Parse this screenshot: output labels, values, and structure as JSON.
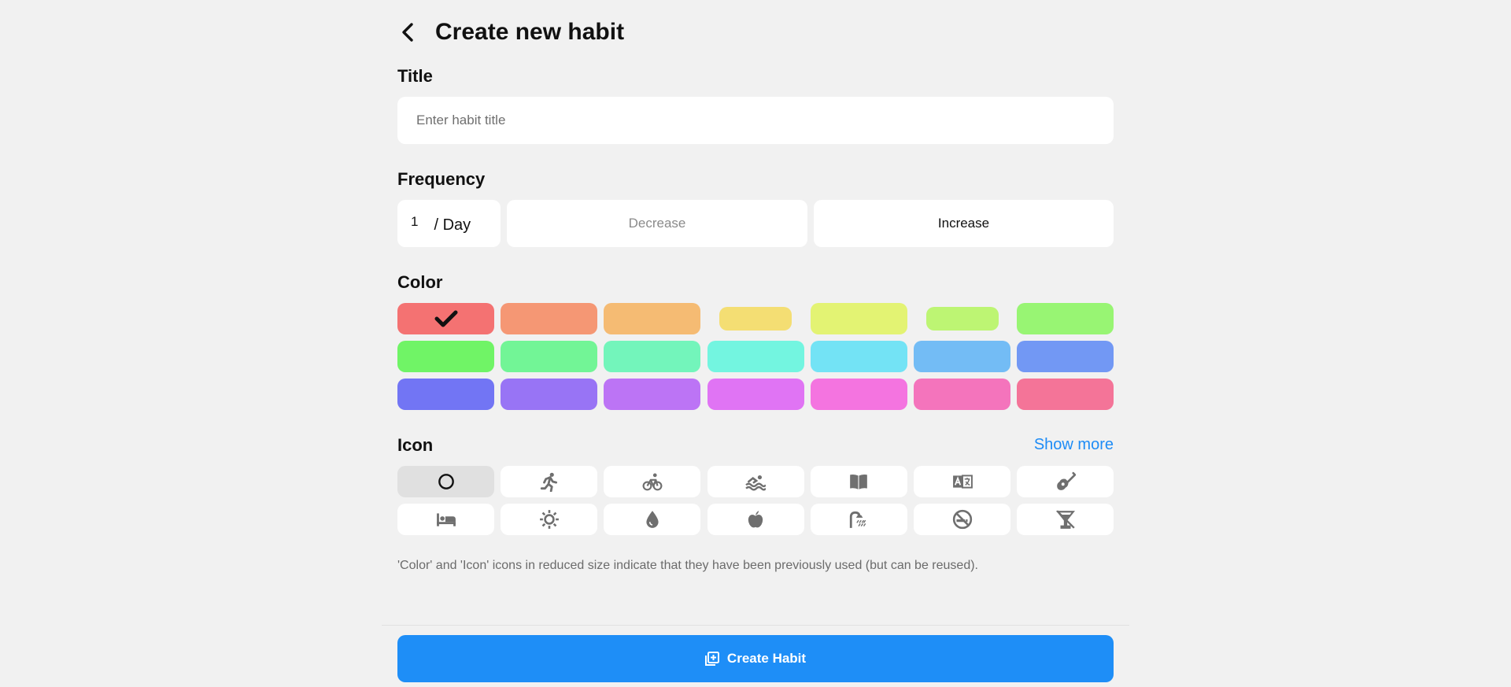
{
  "header": {
    "title": "Create new habit"
  },
  "title_section": {
    "label": "Title",
    "placeholder": "Enter habit title",
    "value": ""
  },
  "frequency": {
    "label": "Frequency",
    "value": "1",
    "unit": "/ Day",
    "decrease_label": "Decrease",
    "increase_label": "Increase"
  },
  "color_section": {
    "label": "Color",
    "selected": 0,
    "colors": [
      {
        "hex": "#f47272",
        "used": false
      },
      {
        "hex": "#f59774",
        "used": false
      },
      {
        "hex": "#f5bb73",
        "used": false
      },
      {
        "hex": "#f4de73",
        "used": true
      },
      {
        "hex": "#e3f373",
        "used": false
      },
      {
        "hex": "#bdf573",
        "used": true
      },
      {
        "hex": "#98f573",
        "used": false
      },
      {
        "hex": "#70f466",
        "used": false
      },
      {
        "hex": "#72f596",
        "used": false
      },
      {
        "hex": "#73f5bb",
        "used": false
      },
      {
        "hex": "#73f5e0",
        "used": false
      },
      {
        "hex": "#73e3f5",
        "used": false
      },
      {
        "hex": "#73bcf5",
        "used": false
      },
      {
        "hex": "#7298f4",
        "used": false
      },
      {
        "hex": "#7275f4",
        "used": false
      },
      {
        "hex": "#9874f5",
        "used": false
      },
      {
        "hex": "#bc74f5",
        "used": false
      },
      {
        "hex": "#e074f4",
        "used": false
      },
      {
        "hex": "#f474e0",
        "used": false
      },
      {
        "hex": "#f474bc",
        "used": false
      },
      {
        "hex": "#f47498",
        "used": false
      }
    ]
  },
  "icon_section": {
    "label": "Icon",
    "show_more_label": "Show more",
    "selected": 0,
    "icons": [
      "circle-icon",
      "running-icon",
      "bicycle-icon",
      "swimming-icon",
      "book-icon",
      "translate-icon",
      "guitar-icon",
      "bed-icon",
      "sun-icon",
      "water-drop-icon",
      "apple-icon",
      "shower-icon",
      "no-smoking-icon",
      "no-alcohol-icon"
    ]
  },
  "note": "'Color' and 'Icon' icons in reduced size indicate that they have been previously used (but can be reused).",
  "footer": {
    "create_label": "Create Habit"
  },
  "theme": {
    "accent": "#1e8ef7",
    "icon_gray": "#6f6f6f"
  }
}
